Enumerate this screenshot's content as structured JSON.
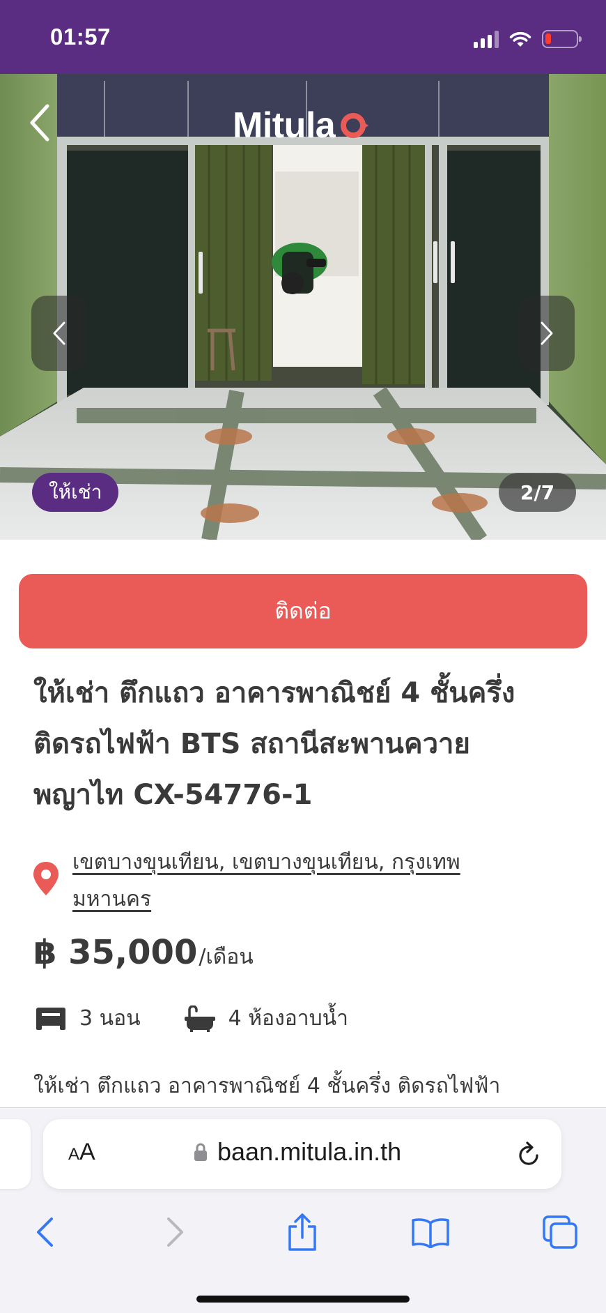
{
  "status_bar": {
    "time": "01:57",
    "icons": [
      "cellular-signal-icon",
      "wifi-icon",
      "battery-low-icon"
    ],
    "background": "#5a2d82"
  },
  "gallery": {
    "logo_text": "Mitula",
    "badge": "ให้เช่า",
    "counter": "2/7"
  },
  "listing": {
    "contact_label": "ติดต่อ",
    "title_lines": [
      "ให้เช่า ตึกแถว อาคารพาณิชย์ 4 ชั้นครึ่ง",
      "ติดรถไฟฟ้า BTS สถานีสะพานควาย",
      "พญาไท CX-54776-1"
    ],
    "location_lines": [
      "เขตบางขุนเทียน, เขตบางขุนเทียน, กรุงเทพ",
      "มหานคร"
    ],
    "price": "฿ 35,000",
    "price_unit": "/เดือน",
    "bedrooms": "3 นอน",
    "bathrooms": "4 ห้องอาบน้ำ",
    "description": "ให้เช่า ตึกแถว อาคารพาณิชย์ 4 ชั้นครึ่ง ติดรถไฟฟ้า"
  },
  "browser": {
    "text_size_small": "A",
    "text_size_big": "A",
    "url": "baan.mitula.in.th",
    "accent": "#3478f6"
  },
  "colors": {
    "brand_purple": "#5a2d82",
    "contact_red": "#ea5a56",
    "text": "#3a3a3a"
  }
}
